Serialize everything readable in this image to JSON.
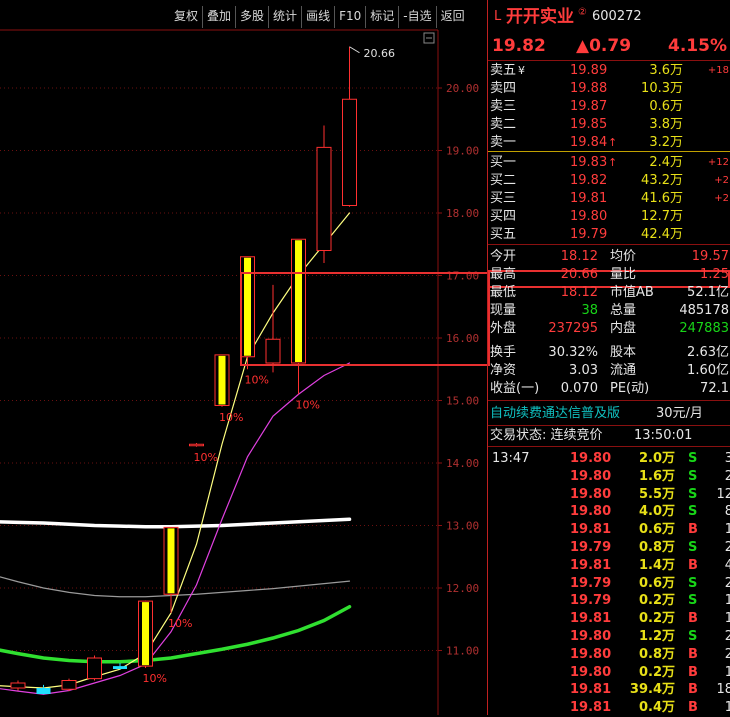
{
  "toolbar": [
    "复权",
    "叠加",
    "多股",
    "统计",
    "画线",
    "F10",
    "标记",
    "-自选",
    "返回"
  ],
  "stock": {
    "tag": "L",
    "name": "开开实业",
    "superscript": "②",
    "code": "600272",
    "price": "19.82",
    "change": "▲0.79",
    "change_pct": "4.15%"
  },
  "chart_data": {
    "type": "candlestick",
    "y_ticks": [
      "20.00",
      "19.00",
      "18.00",
      "17.00",
      "16.00",
      "15.00",
      "14.00",
      "13.00",
      "12.00",
      "11.00"
    ],
    "ylim": [
      10.6,
      20.8
    ],
    "high_label": "20.66",
    "candles": [
      {
        "o": 10.4,
        "c": 10.48,
        "h": 10.52,
        "l": 10.36,
        "color": "red"
      },
      {
        "o": 10.4,
        "c": 10.32,
        "h": 10.45,
        "l": 10.3,
        "color": "cyan"
      },
      {
        "o": 10.38,
        "c": 10.52,
        "h": 10.55,
        "l": 10.35,
        "color": "red"
      },
      {
        "o": 10.55,
        "c": 10.88,
        "h": 10.92,
        "l": 10.52,
        "color": "red"
      },
      {
        "o": 10.72,
        "c": 10.75,
        "h": 10.8,
        "l": 10.7,
        "color": "cyan"
      },
      {
        "o": 10.75,
        "c": 11.79,
        "h": 11.8,
        "l": 10.72,
        "color": "yellow"
      },
      {
        "o": 11.9,
        "c": 12.97,
        "h": 12.97,
        "l": 11.6,
        "color": "yellow"
      },
      {
        "o": 14.28,
        "c": 14.3,
        "h": 14.32,
        "l": 14.26,
        "color": "red"
      },
      {
        "o": 14.92,
        "c": 15.73,
        "h": 15.73,
        "l": 14.9,
        "color": "yellow"
      },
      {
        "o": 15.7,
        "c": 17.3,
        "h": 17.3,
        "l": 15.5,
        "color": "yellow"
      },
      {
        "o": 15.6,
        "c": 15.98,
        "h": 16.85,
        "l": 15.45,
        "color": "red"
      },
      {
        "o": 15.6,
        "c": 17.58,
        "h": 17.58,
        "l": 15.1,
        "color": "yellow"
      },
      {
        "o": 17.4,
        "c": 19.05,
        "h": 19.4,
        "l": 17.2,
        "color": "red"
      },
      {
        "o": 18.12,
        "c": 19.82,
        "h": 20.66,
        "l": 18.1,
        "color": "red"
      }
    ],
    "limit_labels": [
      {
        "i": 5,
        "text": "10%"
      },
      {
        "i": 6,
        "text": "10%"
      },
      {
        "i": 7,
        "text": "10%"
      },
      {
        "i": 8,
        "text": "10%"
      },
      {
        "i": 9,
        "text": "10%"
      },
      {
        "i": 11,
        "text": "10%"
      }
    ],
    "ma_lines": [
      {
        "color": "#ffffff",
        "width": 3.5,
        "values": [
          13.05,
          13.04,
          13.02,
          13.0,
          12.99,
          12.98,
          12.98,
          12.99,
          13.0,
          13.02,
          13.04,
          13.06,
          13.08,
          13.1
        ]
      },
      {
        "color": "#9a9a9a",
        "width": 1.2,
        "values": [
          12.1,
          12.0,
          11.93,
          11.88,
          11.86,
          11.86,
          11.88,
          11.9,
          11.93,
          11.96,
          11.99,
          12.03,
          12.07,
          12.11
        ]
      },
      {
        "color": "#30e030",
        "width": 3.5,
        "values": [
          10.95,
          10.88,
          10.84,
          10.82,
          10.82,
          10.84,
          10.88,
          10.95,
          11.02,
          11.1,
          11.2,
          11.32,
          11.48,
          11.7
        ]
      },
      {
        "color": "#e040e0",
        "width": 1.2,
        "values": [
          10.35,
          10.3,
          10.36,
          10.48,
          10.6,
          10.78,
          11.3,
          12.05,
          13.1,
          14.1,
          14.75,
          15.1,
          15.4,
          15.6
        ]
      },
      {
        "color": "#ffff80",
        "width": 1.2,
        "values": [
          10.42,
          10.4,
          10.45,
          10.58,
          10.7,
          10.95,
          11.6,
          12.7,
          14.3,
          15.7,
          16.4,
          17.0,
          17.5,
          18.0
        ]
      }
    ]
  },
  "orderbook": {
    "sell": [
      {
        "label": "卖五",
        "mark": "¥",
        "price": "19.89",
        "vol": "3.6万",
        "delta": "+18"
      },
      {
        "label": "卖四",
        "mark": "",
        "price": "19.88",
        "vol": "10.3万",
        "delta": ""
      },
      {
        "label": "卖三",
        "mark": "",
        "price": "19.87",
        "vol": "0.6万",
        "delta": ""
      },
      {
        "label": "卖二",
        "mark": "",
        "price": "19.85",
        "vol": "3.8万",
        "delta": ""
      },
      {
        "label": "卖一",
        "mark": "",
        "price": "19.84",
        "vol": "3.2万",
        "delta": "",
        "arrow": "↑"
      }
    ],
    "buy": [
      {
        "label": "买一",
        "price": "19.83",
        "vol": "2.4万",
        "delta": "+12",
        "arrow": "↑"
      },
      {
        "label": "买二",
        "price": "19.82",
        "vol": "43.2万",
        "delta": "+2"
      },
      {
        "label": "买三",
        "price": "19.81",
        "vol": "41.6万",
        "delta": "+2"
      },
      {
        "label": "买四",
        "price": "19.80",
        "vol": "12.7万",
        "delta": ""
      },
      {
        "label": "买五",
        "price": "19.79",
        "vol": "42.4万",
        "delta": ""
      }
    ]
  },
  "stats": [
    {
      "k1": "今开",
      "v1": "18.12",
      "c1": "red",
      "k2": "均价",
      "v2": "19.57",
      "c2": "red"
    },
    {
      "k1": "最高",
      "v1": "20.66",
      "c1": "red",
      "k2": "量比",
      "v2": "1.25",
      "c2": "red"
    },
    {
      "k1": "最低",
      "v1": "18.12",
      "c1": "red",
      "k2": "市值AB",
      "v2": "52.1亿",
      "c2": "white"
    },
    {
      "k1": "现量",
      "v1": "38",
      "c1": "green",
      "k2": "总量",
      "v2": "485178",
      "c2": "white"
    },
    {
      "k1": "外盘",
      "v1": "237295",
      "c1": "red",
      "k2": "内盘",
      "v2": "247883",
      "c2": "green"
    },
    {
      "k1": "换手",
      "v1": "30.32%",
      "c1": "white",
      "k2": "股本",
      "v2": "2.63亿",
      "c2": "white"
    },
    {
      "k1": "净资",
      "v1": "3.03",
      "c1": "white",
      "k2": "流通",
      "v2": "1.60亿",
      "c2": "white"
    },
    {
      "k1": "收益(一)",
      "v1": "0.070",
      "c1": "white",
      "k2": "PE(动)",
      "v2": "72.1",
      "c2": "white"
    }
  ],
  "promo": {
    "left": "自动续费通达信普及版",
    "right": "30元/月"
  },
  "trade_status": {
    "label": "交易状态: 连续竞价",
    "time": "13:50:01"
  },
  "ticks": [
    {
      "t": "13:47",
      "p": "19.80",
      "pc": "red",
      "v": "2.0万",
      "s": "S",
      "n": "3"
    },
    {
      "t": "",
      "p": "19.80",
      "pc": "red",
      "v": "1.6万",
      "s": "S",
      "n": "2"
    },
    {
      "t": "",
      "p": "19.80",
      "pc": "red",
      "v": "5.5万",
      "s": "S",
      "n": "12"
    },
    {
      "t": "",
      "p": "19.80",
      "pc": "red",
      "v": "4.0万",
      "s": "S",
      "n": "8"
    },
    {
      "t": "",
      "p": "19.81",
      "pc": "red",
      "v": "0.6万",
      "s": "B",
      "n": "1"
    },
    {
      "t": "",
      "p": "19.79",
      "pc": "red",
      "v": "0.8万",
      "s": "S",
      "n": "2"
    },
    {
      "t": "",
      "p": "19.81",
      "pc": "red",
      "v": "1.4万",
      "s": "B",
      "n": "4"
    },
    {
      "t": "",
      "p": "19.79",
      "pc": "red",
      "v": "0.6万",
      "s": "S",
      "n": "2"
    },
    {
      "t": "",
      "p": "19.79",
      "pc": "red",
      "v": "0.2万",
      "s": "S",
      "n": "1"
    },
    {
      "t": "",
      "p": "19.81",
      "pc": "red",
      "v": "0.2万",
      "s": "B",
      "n": "1"
    },
    {
      "t": "",
      "p": "19.80",
      "pc": "red",
      "v": "1.2万",
      "s": "S",
      "n": "2"
    },
    {
      "t": "",
      "p": "19.80",
      "pc": "red",
      "v": "0.8万",
      "s": "B",
      "n": "2"
    },
    {
      "t": "",
      "p": "19.80",
      "pc": "red",
      "v": "0.2万",
      "s": "B",
      "n": "1"
    },
    {
      "t": "",
      "p": "19.81",
      "pc": "red",
      "v": "39.4万",
      "s": "B",
      "n": "18"
    },
    {
      "t": "",
      "p": "19.81",
      "pc": "red",
      "v": "0.4万",
      "s": "B",
      "n": "1"
    }
  ]
}
